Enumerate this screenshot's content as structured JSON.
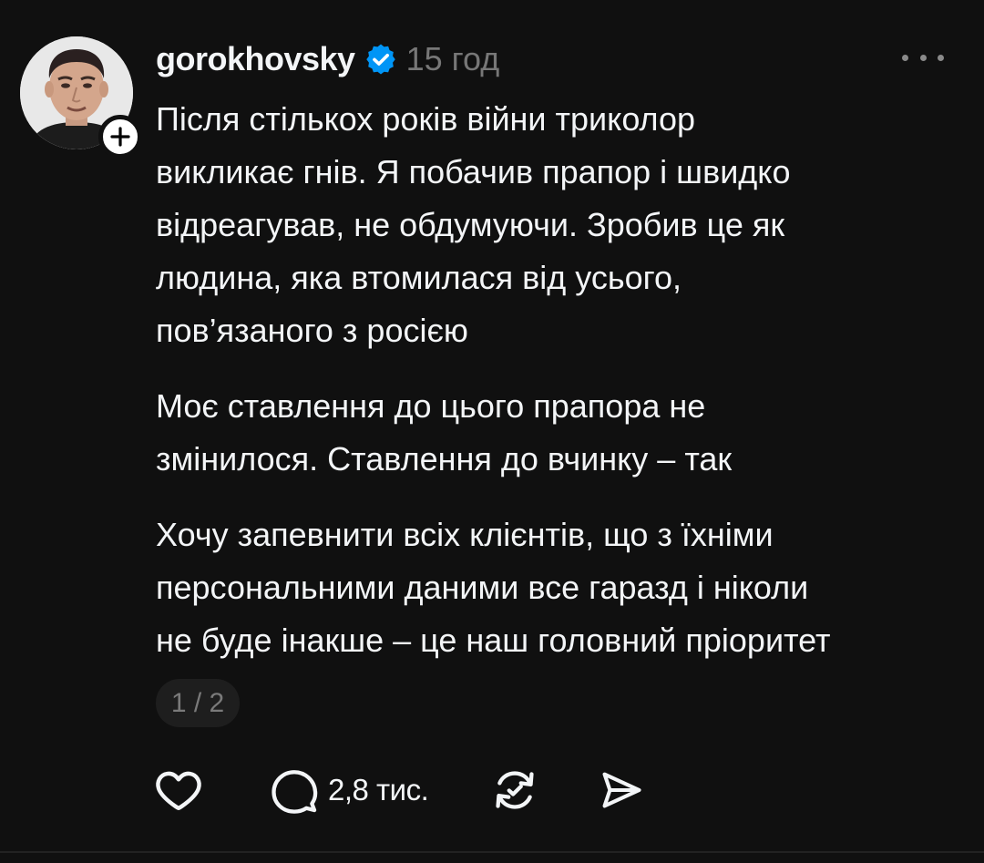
{
  "post": {
    "username": "gorokhovsky",
    "time": "15 год",
    "paragraphs": [
      "Після стількох років війни триколор\nвикликає гнів. Я побачив прапор і швидко\nвідреагував, не обдумуючи. Зробив це як\nлюдина, яка втомилася від усього,\nпов’язаного з росією",
      "Моє ставлення до цього прапора не\nзмінилося. Ставлення до вчинку – так",
      "Хочу запевнити всіх клієнтів, що з їхніми\nперсональними даними все гаразд і ніколи\nне буде інакше – це наш головний пріоритет"
    ],
    "page_indicator": "1 / 2"
  },
  "actions": {
    "comment_count": "2,8 тис."
  },
  "icons": {
    "verified": "verified-badge-icon",
    "follow": "plus-icon",
    "more": "more-dots-icon",
    "like": "heart-icon",
    "comment": "comment-bubble-icon",
    "repost": "repost-icon",
    "share": "send-icon"
  },
  "colors": {
    "background": "#101010",
    "text": "#f3f5f7",
    "muted": "#777777",
    "verified": "#0095f6"
  }
}
